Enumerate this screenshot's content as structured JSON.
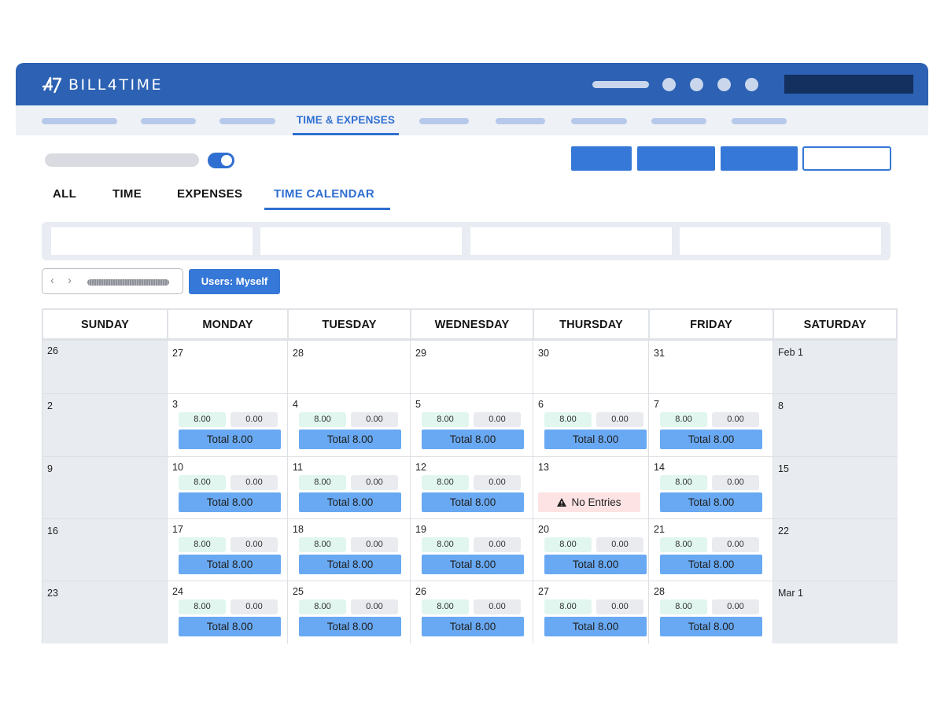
{
  "app": {
    "logo_text": "BILL4TIME"
  },
  "nav": {
    "active_label": "TIME & EXPENSES"
  },
  "tabs": [
    "ALL",
    "TIME",
    "EXPENSES",
    "TIME CALENDAR"
  ],
  "active_tab": "TIME CALENDAR",
  "filter": {
    "users_label": "Users: Myself"
  },
  "calendar": {
    "days": [
      "SUNDAY",
      "MONDAY",
      "TUESDAY",
      "WEDNESDAY",
      "THURSDAY",
      "FRIDAY",
      "SATURDAY"
    ],
    "total_prefix": "Total",
    "no_entries_label": "No Entries",
    "weeks": [
      [
        {
          "day": "26"
        },
        {
          "day": "27"
        },
        {
          "day": "28"
        },
        {
          "day": "29"
        },
        {
          "day": "30"
        },
        {
          "day": "31"
        },
        {
          "day": "Feb 1"
        }
      ],
      [
        {
          "day": "2"
        },
        {
          "day": "3",
          "hours": "8.00",
          "expenses": "0.00",
          "total": "8.00"
        },
        {
          "day": "4",
          "hours": "8.00",
          "expenses": "0.00",
          "total": "8.00"
        },
        {
          "day": "5",
          "hours": "8.00",
          "expenses": "0.00",
          "total": "8.00"
        },
        {
          "day": "6",
          "hours": "8.00",
          "expenses": "0.00",
          "total": "8.00"
        },
        {
          "day": "7",
          "hours": "8.00",
          "expenses": "0.00",
          "total": "8.00"
        },
        {
          "day": "8"
        }
      ],
      [
        {
          "day": "9"
        },
        {
          "day": "10",
          "hours": "8.00",
          "expenses": "0.00",
          "total": "8.00"
        },
        {
          "day": "11",
          "hours": "8.00",
          "expenses": "0.00",
          "total": "8.00"
        },
        {
          "day": "12",
          "hours": "8.00",
          "expenses": "0.00",
          "total": "8.00"
        },
        {
          "day": "13",
          "no_entries": true
        },
        {
          "day": "14",
          "hours": "8.00",
          "expenses": "0.00",
          "total": "8.00"
        },
        {
          "day": "15"
        }
      ],
      [
        {
          "day": "16"
        },
        {
          "day": "17",
          "hours": "8.00",
          "expenses": "0.00",
          "total": "8.00"
        },
        {
          "day": "18",
          "hours": "8.00",
          "expenses": "0.00",
          "total": "8.00"
        },
        {
          "day": "19",
          "hours": "8.00",
          "expenses": "0.00",
          "total": "8.00"
        },
        {
          "day": "20",
          "hours": "8.00",
          "expenses": "0.00",
          "total": "8.00"
        },
        {
          "day": "21",
          "hours": "8.00",
          "expenses": "0.00",
          "total": "8.00"
        },
        {
          "day": "22"
        }
      ],
      [
        {
          "day": "23"
        },
        {
          "day": "24",
          "hours": "8.00",
          "expenses": "0.00",
          "total": "8.00"
        },
        {
          "day": "25",
          "hours": "8.00",
          "expenses": "0.00",
          "total": "8.00"
        },
        {
          "day": "26",
          "hours": "8.00",
          "expenses": "0.00",
          "total": "8.00"
        },
        {
          "day": "27",
          "hours": "8.00",
          "expenses": "0.00",
          "total": "8.00"
        },
        {
          "day": "28",
          "hours": "8.00",
          "expenses": "0.00",
          "total": "8.00"
        },
        {
          "day": "Mar 1"
        }
      ]
    ]
  },
  "icons": {
    "logo": "bill4time-logo-icon",
    "warning": "warning-icon",
    "prev": "chevron-left-icon",
    "next": "chevron-right-icon"
  },
  "colors": {
    "brand_blue": "#2c61b3",
    "accent_blue": "#2f6fd1",
    "total_button": "#69a9f3",
    "hours_chip": "#e0f6ef",
    "no_entries": "#fde3e3"
  }
}
